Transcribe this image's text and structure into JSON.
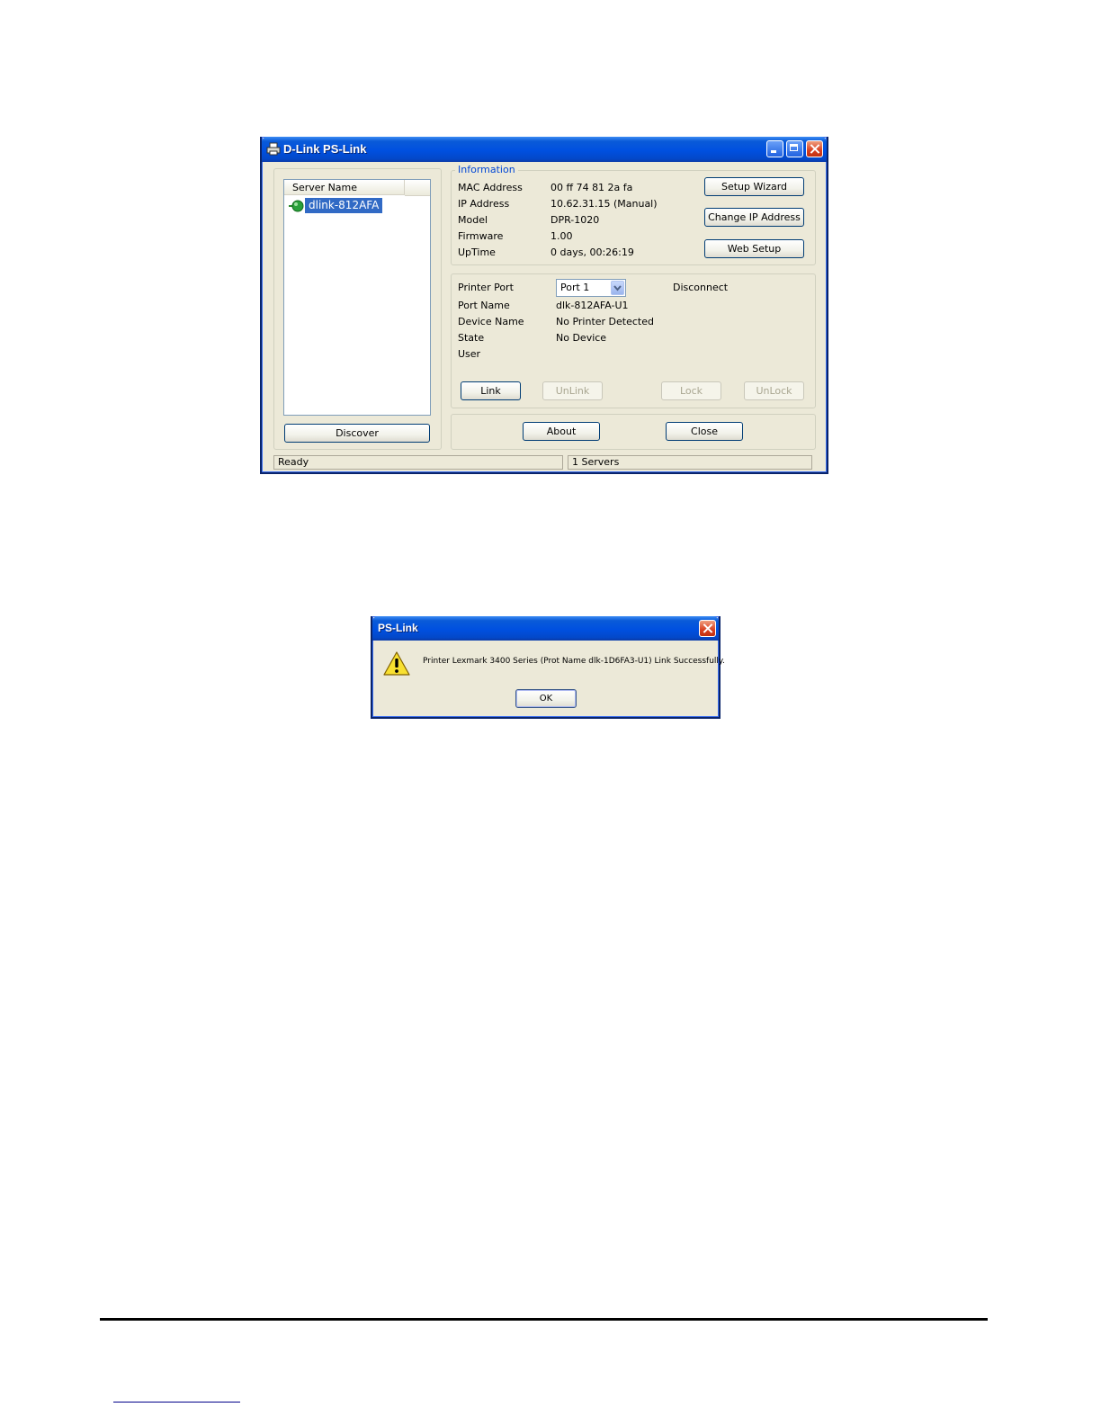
{
  "main_window": {
    "title": "D-Link PS-Link",
    "server_list": {
      "column_header": "Server Name",
      "items": [
        "dlink-812AFA"
      ]
    },
    "discover_label": "Discover",
    "info": {
      "legend": "Information",
      "rows": [
        {
          "label": "MAC Address",
          "value": "00 ff 74 81 2a fa"
        },
        {
          "label": "IP Address",
          "value": "10.62.31.15 (Manual)"
        },
        {
          "label": "Model",
          "value": "DPR-1020"
        },
        {
          "label": "Firmware",
          "value": "1.00"
        },
        {
          "label": "UpTime",
          "value": "0 days, 00:26:19"
        }
      ],
      "setup_wizard_label": "Setup Wizard",
      "change_ip_label": "Change IP Address",
      "web_setup_label": "Web Setup"
    },
    "port": {
      "printer_port_label": "Printer Port",
      "printer_port_value": "Port 1",
      "connection_status": "Disconnect",
      "rows": [
        {
          "label": "Port Name",
          "value": "dlk-812AFA-U1"
        },
        {
          "label": "Device Name",
          "value": "No Printer Detected"
        },
        {
          "label": "State",
          "value": "No Device"
        },
        {
          "label": "User",
          "value": ""
        }
      ],
      "link_label": "Link",
      "unlink_label": "UnLink",
      "lock_label": "Lock",
      "unlock_label": "UnLock"
    },
    "about_label": "About",
    "close_label": "Close",
    "status": {
      "left": "Ready",
      "right": "1 Servers"
    }
  },
  "dialog": {
    "title": "PS-Link",
    "message": "Printer Lexmark 3400 Series (Prot Name dlk-1D6FA3-U1) Link Successfully.",
    "ok_label": "OK"
  }
}
